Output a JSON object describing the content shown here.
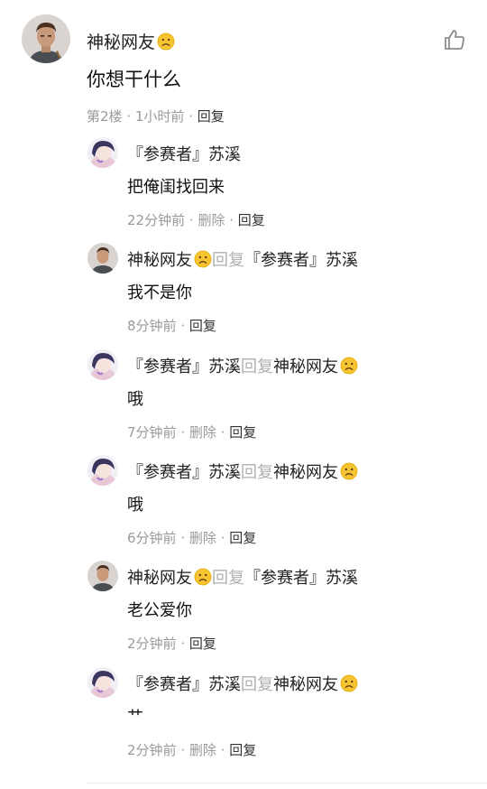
{
  "main_comment": {
    "author": "神秘网友",
    "author_emoji": "frowning-face-icon",
    "text": "你想干什么",
    "floor": "第2楼",
    "time": "1小时前",
    "reply_label": "回复",
    "like_icon": "thumbs-up-outline-icon"
  },
  "replies": [
    {
      "author": "『参赛者』苏溪",
      "reply_word": "",
      "target": "",
      "text": "把俺闺找回来",
      "time": "22分钟前",
      "delete_label": "删除",
      "reply_label": "回复"
    },
    {
      "author": "神秘网友",
      "reply_word": "回复",
      "target": "『参赛者』苏溪",
      "text": "我不是你",
      "time": "8分钟前",
      "reply_label": "回复"
    },
    {
      "author": "『参赛者』苏溪",
      "reply_word": "回复",
      "target": "神秘网友",
      "text": "哦",
      "time": "7分钟前",
      "delete_label": "删除",
      "reply_label": "回复"
    },
    {
      "author": "『参赛者』苏溪",
      "reply_word": "回复",
      "target": "神秘网友",
      "text": "哦",
      "time": "6分钟前",
      "delete_label": "删除",
      "reply_label": "回复"
    },
    {
      "author": "神秘网友",
      "reply_word": "回复",
      "target": "『参赛者』苏溪",
      "text": "老公爱你",
      "time": "2分钟前",
      "reply_label": "回复"
    },
    {
      "author": "『参赛者』苏溪",
      "reply_word": "回复",
      "target": "神秘网友",
      "text": "艹",
      "time": "2分钟前",
      "delete_label": "删除",
      "reply_label": "回复"
    }
  ],
  "separator": "·",
  "colors": {
    "text": "#222222",
    "meta": "#9a9a9a",
    "reply_word": "#b0b0b0"
  }
}
